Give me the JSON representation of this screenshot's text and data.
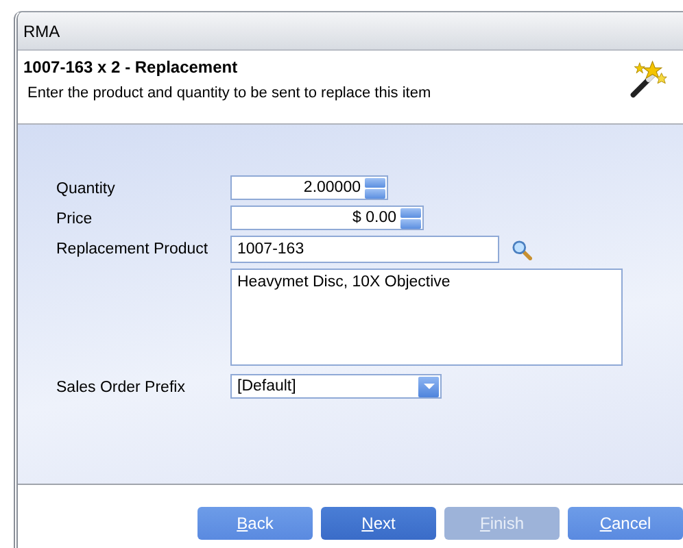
{
  "window": {
    "title": "RMA"
  },
  "header": {
    "title": "1007-163 x 2 - Replacement",
    "subtitle": "Enter the product and quantity to be sent to replace this item"
  },
  "form": {
    "quantity": {
      "label": "Quantity",
      "value": "2.00000"
    },
    "price": {
      "label": "Price",
      "value": "$ 0.00"
    },
    "replacement_product": {
      "label": "Replacement Product",
      "value": "1007-163",
      "description": "Heavymet Disc, 10X Objective"
    },
    "sales_order_prefix": {
      "label": "Sales Order Prefix",
      "value": "[Default]"
    }
  },
  "buttons": [
    {
      "label": "Back",
      "disabled": false,
      "default": false
    },
    {
      "label": "Next",
      "disabled": false,
      "default": true
    },
    {
      "label": "Finish",
      "disabled": true,
      "default": false
    },
    {
      "label": "Cancel",
      "disabled": false,
      "default": false
    }
  ]
}
